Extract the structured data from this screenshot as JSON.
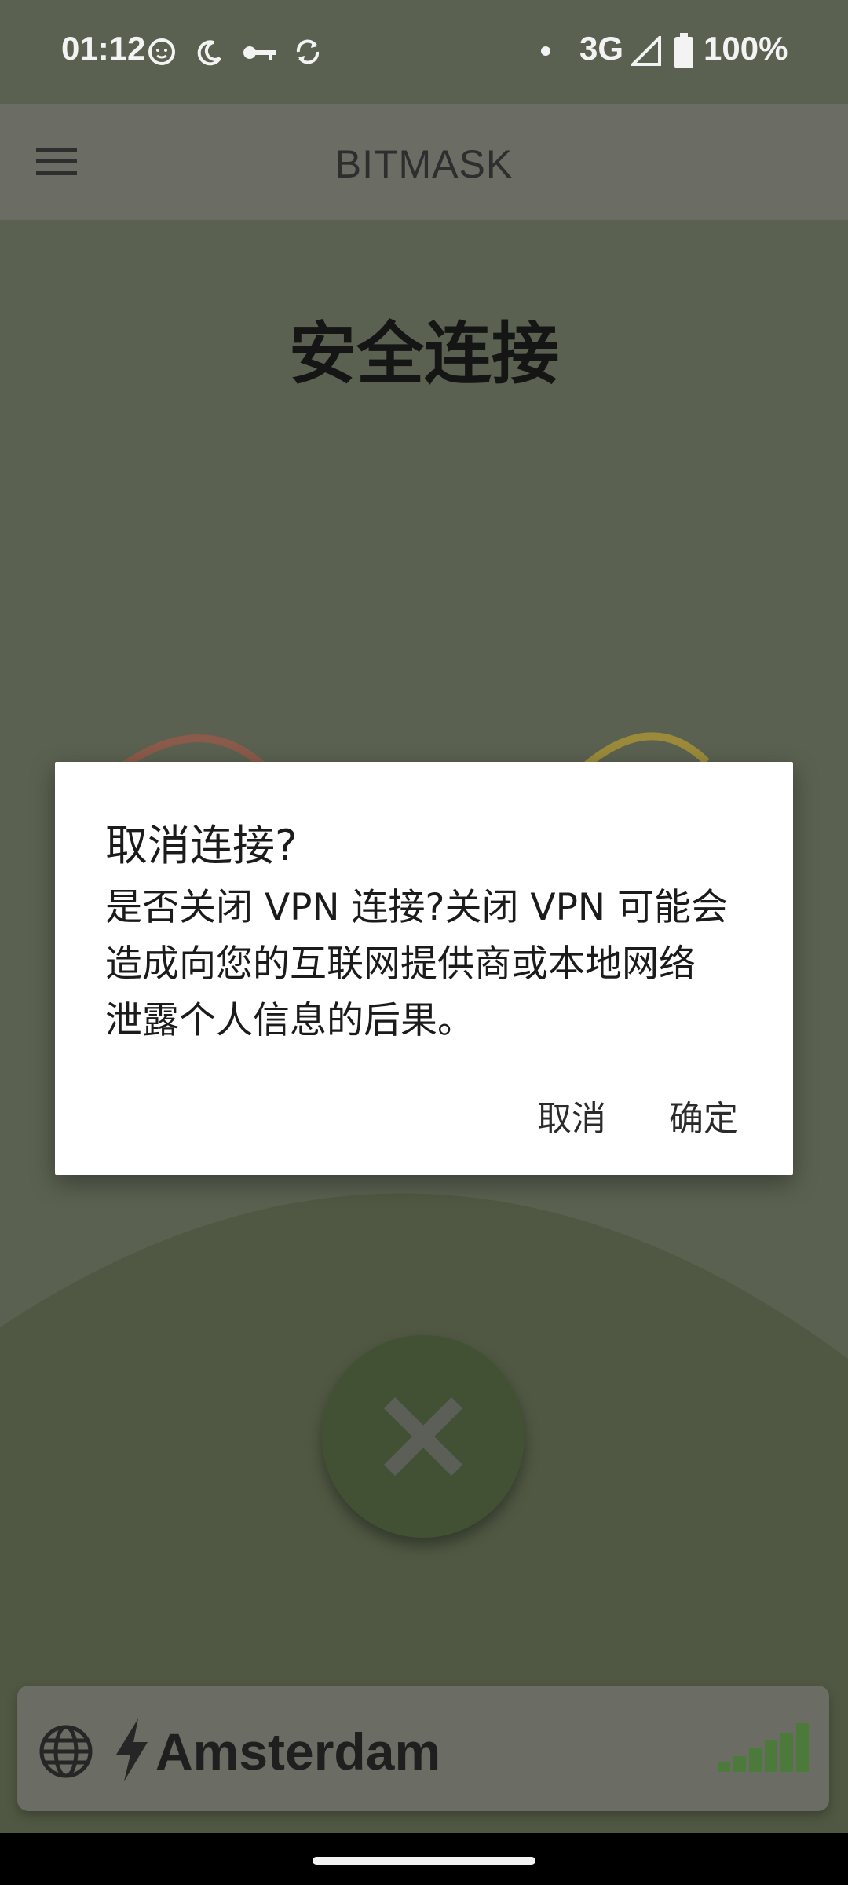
{
  "status_bar": {
    "time": "01:12",
    "network": "3G",
    "battery": "100%",
    "icons": [
      "face-icon",
      "moon-icon",
      "key-icon",
      "sync-icon",
      "dot-icon",
      "signal-icon",
      "battery-icon"
    ]
  },
  "app_bar": {
    "title": "BITMASK",
    "menu_icon": "hamburger-menu-icon"
  },
  "main": {
    "headline": "安全连接",
    "disconnect_icon": "close-x-icon"
  },
  "location_bar": {
    "location": "Amsterdam",
    "icons": [
      "globe-icon",
      "lightning-icon",
      "signal-strength-icon"
    ]
  },
  "dialog": {
    "title": "取消连接?",
    "body_lines": [
      "是否关闭 VPN 连接?关闭 VPN 可能会",
      "造成向您的互联网提供商或本地网络",
      "泄露个人信息的后果。"
    ],
    "cancel_label": "取消",
    "confirm_label": "确定"
  },
  "colors": {
    "scrim_background": "#5a6150",
    "dialog_background": "#ffffff",
    "disconnect_button": "#425034",
    "signal_bars": "#4c7a3a"
  }
}
